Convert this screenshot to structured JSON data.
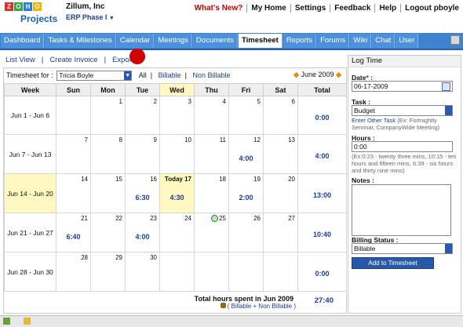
{
  "header": {
    "company": "Zillum, Inc",
    "project": "ERP Phase I",
    "project_chevron": "▼",
    "logo_projects": "Projects",
    "links": [
      "What's New?",
      "My Home",
      "Settings",
      "Feedback",
      "Help",
      "Logout pboyle"
    ]
  },
  "tabs": [
    {
      "label": "Dashboard"
    },
    {
      "label": "Tasks & Milestones"
    },
    {
      "label": "Calendar"
    },
    {
      "label": "Meetings"
    },
    {
      "label": "Documents"
    },
    {
      "label": "Timesheet",
      "active": true
    },
    {
      "label": "Reports"
    },
    {
      "label": "Forums"
    },
    {
      "label": "Wiki"
    },
    {
      "label": "Chat"
    },
    {
      "label": "User"
    }
  ],
  "subnav": {
    "list_view": "List View",
    "create_invoice": "Create Invoice",
    "export": "Export",
    "sep": "|"
  },
  "filter": {
    "label": "Timesheet for :",
    "user": "Tricia Boyle",
    "all": "All",
    "billable": "Billable",
    "non_billable": "Non Billable",
    "month": "June 2009"
  },
  "calendar": {
    "headers": [
      "Week",
      "Sun",
      "Mon",
      "Tue",
      "Wed",
      "Thu",
      "Fri",
      "Sat",
      "Total"
    ],
    "weeks": [
      {
        "label": "Jun 1 - Jun 6",
        "days": [
          "",
          "1",
          "2",
          "3",
          "4",
          "5",
          "6"
        ],
        "hours": [
          "",
          "",
          "",
          "",
          "",
          "",
          ""
        ],
        "total": "0:00"
      },
      {
        "label": "Jun 7 - Jun 13",
        "days": [
          "7",
          "8",
          "9",
          "10",
          "11",
          "12",
          "13"
        ],
        "hours": [
          "",
          "",
          "",
          "",
          "",
          "4:00",
          ""
        ],
        "total": "4:00"
      },
      {
        "label": "Jun 14 - Jun 20",
        "days": [
          "14",
          "15",
          "16",
          "Today 17",
          "18",
          "19",
          "20"
        ],
        "hours": [
          "",
          "",
          "6:30",
          "4:30",
          "",
          "2:00",
          ""
        ],
        "total": "13:00"
      },
      {
        "label": "Jun 21 - Jun 27",
        "days": [
          "21",
          "22",
          "23",
          "24",
          "25",
          "26",
          "27"
        ],
        "hours": [
          "6:40",
          "",
          "4:00",
          "",
          "",
          "",
          ""
        ],
        "total": "10:40"
      },
      {
        "label": "Jun 28 - Jun 30",
        "days": [
          "28",
          "29",
          "30",
          "",
          "",
          "",
          ""
        ],
        "hours": [
          "",
          "",
          "",
          "",
          "",
          "",
          ""
        ],
        "total": "0:00"
      }
    ],
    "summary_label": "Total hours spent in  Jun 2009",
    "summary_sub": "( Billable + Non Billable )",
    "grand_total": "27:40"
  },
  "log_time": {
    "title": "Log Time",
    "date_label": "Date",
    "date_required": "*",
    "date_value": "06-17-2009",
    "task_label": "Task :",
    "task_value": "Budget",
    "other_task_link": "Enter Other Task",
    "other_task_hint": "(Ex: Fortnightly Seminar, CompanyWide Meeting)",
    "hours_label": "Hours :",
    "hours_value": "0:00",
    "hours_hint": "(Ex:0:23 - twenty three mins, 10:15 - ten hours and fifteen mins, 6:39 - six hours and thirty nine mins)",
    "notes_label": "Notes :",
    "billing_label": "Billing Status :",
    "billing_value": "Billable",
    "submit_label": "Add to Timesheet"
  },
  "colors": {
    "tab_bar": "#3f82cf",
    "today_highlight": "#fff8c0",
    "link": "#1b3e90",
    "marker": "#d10000"
  }
}
